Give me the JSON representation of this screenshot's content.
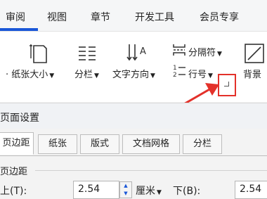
{
  "menu": {
    "items": [
      "审阅",
      "视图",
      "章节",
      "开发工具",
      "会员专享"
    ]
  },
  "ribbon": {
    "paper_size_label": "纸张大小",
    "columns_label": "分栏",
    "text_direction_label": "文字方向",
    "separator_label": "分隔符",
    "line_number_label": "行号",
    "background_label": "背景",
    "text_direction_icon_letter": "A"
  },
  "dialog": {
    "title": "页面设置",
    "tabs": [
      "页边距",
      "纸张",
      "版式",
      "文档网格",
      "分栏"
    ],
    "section_title": "页边距",
    "top_label": "上(T):",
    "top_value": "2.54",
    "unit": "厘米",
    "bottom_label": "下(B):",
    "bottom_value": "2.54"
  },
  "colors": {
    "accent": "#1a57d8",
    "highlight": "#e3312a"
  }
}
